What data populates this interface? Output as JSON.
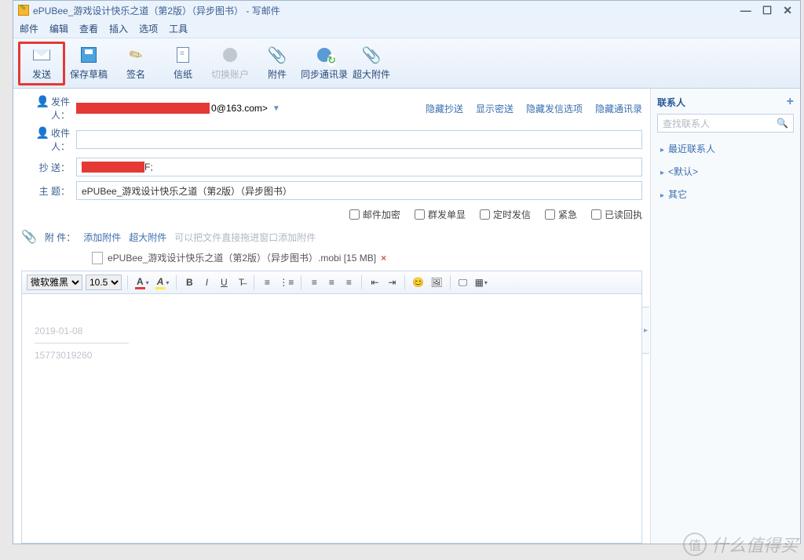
{
  "window": {
    "title": "ePUBee_游戏设计快乐之道（第2版）（异步图书） - 写邮件",
    "min": "—",
    "max": "☐",
    "close": "✕"
  },
  "menu": {
    "mail": "邮件",
    "edit": "编辑",
    "view": "查看",
    "insert": "插入",
    "options": "选项",
    "tools": "工具"
  },
  "toolbar": {
    "send": "发送",
    "draft": "保存草稿",
    "sign": "签名",
    "paper": "信纸",
    "switch": "切换账户",
    "attach": "附件",
    "sync": "同步通讯录",
    "big": "超大附件"
  },
  "fields": {
    "from_label": "发件人：",
    "from_suffix": "0@163.com>",
    "to_label": "收件人：",
    "cc_label": "抄 送：",
    "cc_suffix": "F;",
    "subject_label": "主 题：",
    "subject_value": "ePUBee_游戏设计快乐之道（第2版）（异步图书）",
    "links": {
      "hide_bcc": "隐藏抄送",
      "show_bcc": "显示密送",
      "hide_opts": "隐藏发信选项",
      "hide_contacts": "隐藏通讯录"
    }
  },
  "options": {
    "encrypt": "邮件加密",
    "single": "群发单显",
    "schedule": "定时发信",
    "urgent": "紧急",
    "receipt": "已读回执"
  },
  "attach": {
    "label": "附 件：",
    "add": "添加附件",
    "big": "超大附件",
    "hint": "可以把文件直接拖进窗口添加附件",
    "file": "ePUBee_游戏设计快乐之道（第2版）（异步图书）.mobi [15 MB]"
  },
  "editor": {
    "font": "微软雅黑",
    "size": "10.5",
    "body_date": "2019-01-08",
    "body_sig": "15773019260"
  },
  "contacts": {
    "title": "联系人",
    "search_placeholder": "查找联系人",
    "recent": "最近联系人",
    "default": "<默认>",
    "other": "其它"
  },
  "watermark": "什么值得买"
}
